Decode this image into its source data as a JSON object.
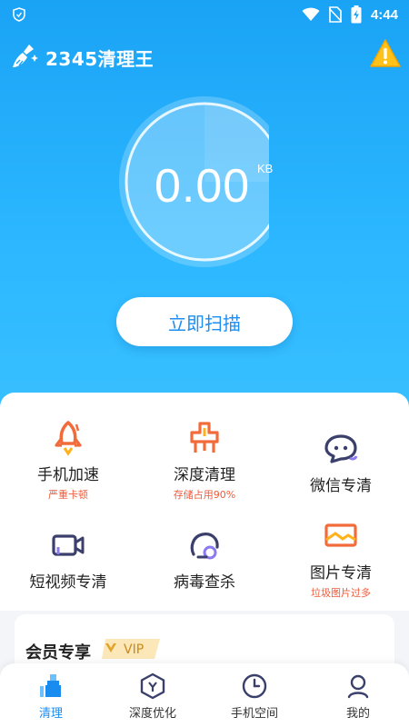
{
  "status_bar": {
    "time": "4:44"
  },
  "header": {
    "app_title": "2345清理王"
  },
  "gauge": {
    "value": "0.00",
    "unit": "KB"
  },
  "scan_button": {
    "label": "立即扫描"
  },
  "tools": [
    {
      "name": "手机加速",
      "sub": "严重卡顿",
      "icon": "rocket-icon"
    },
    {
      "name": "深度清理",
      "sub": "存储占用90%",
      "icon": "deep-clean-icon"
    },
    {
      "name": "微信专清",
      "sub": "",
      "icon": "wechat-icon"
    },
    {
      "name": "短视频专清",
      "sub": "",
      "icon": "video-icon"
    },
    {
      "name": "病毒查杀",
      "sub": "",
      "icon": "virus-icon"
    },
    {
      "name": "图片专清",
      "sub": "垃圾图片过多",
      "icon": "picture-icon"
    }
  ],
  "member": {
    "title": "会员专享",
    "badge": "VIP"
  },
  "bottom_nav": [
    {
      "label": "清理",
      "active": true,
      "icon": "clean-icon"
    },
    {
      "label": "深度优化",
      "active": false,
      "icon": "optimize-icon"
    },
    {
      "label": "手机空间",
      "active": false,
      "icon": "clock-icon"
    },
    {
      "label": "我的",
      "active": false,
      "icon": "profile-icon"
    }
  ],
  "colors": {
    "accent": "#1a8cf0",
    "hero_top": "#1aa3f5",
    "warning": "#f05a3a",
    "tool_orange": "#f26b3a"
  }
}
